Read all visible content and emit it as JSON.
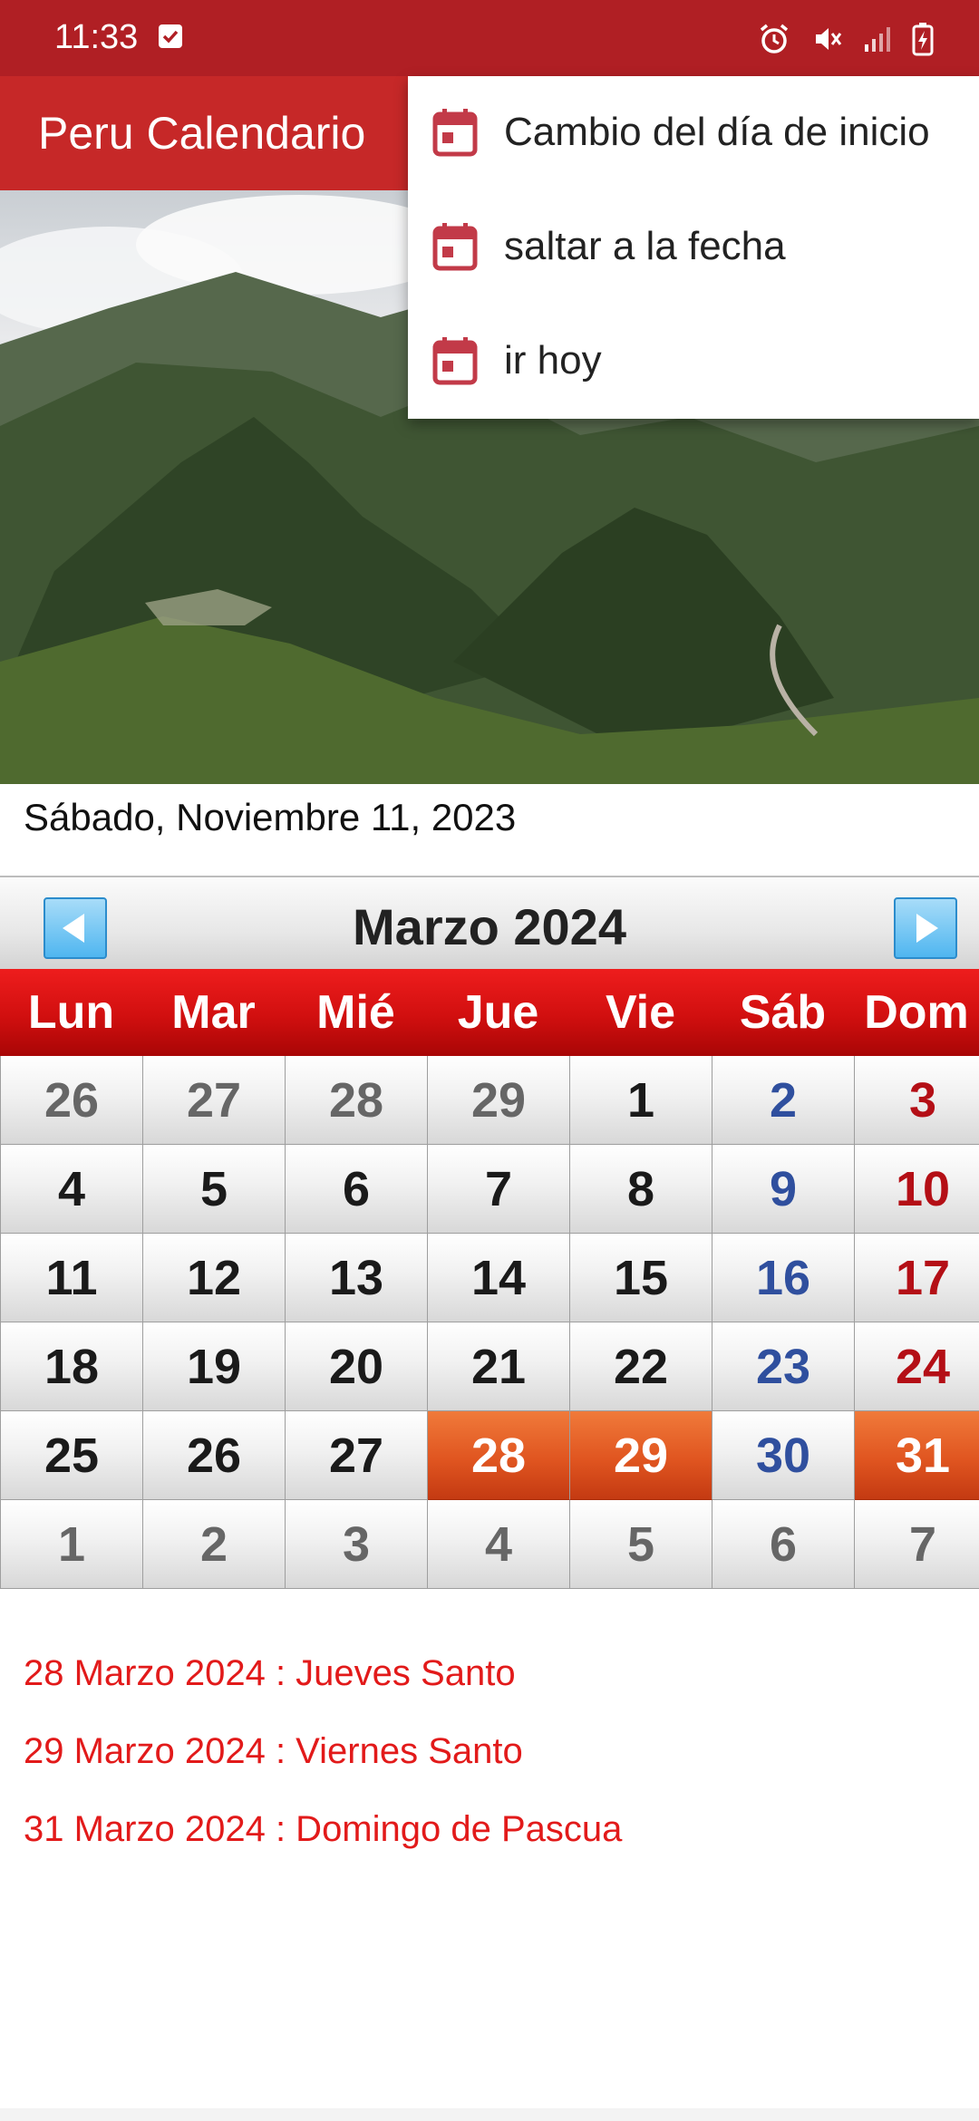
{
  "status_bar": {
    "time": "11:33",
    "icons": [
      "checkbox-icon",
      "alarm-icon",
      "vibrate-icon",
      "signal-icon",
      "battery-icon"
    ]
  },
  "app_bar": {
    "title": "Peru Calendario"
  },
  "menu": {
    "items": [
      {
        "label": "Cambio del día de inicio",
        "icon": "calendar-icon"
      },
      {
        "label": "saltar a la fecha",
        "icon": "calendar-icon"
      },
      {
        "label": "ir hoy",
        "icon": "calendar-icon"
      }
    ]
  },
  "today": "Sábado, Noviembre 11, 2023",
  "calendar": {
    "month_title": "Marzo  2024",
    "weekdays": [
      "Lun",
      "Mar",
      "Mié",
      "Jue",
      "Vie",
      "Sáb",
      "Dom"
    ],
    "weeks": [
      [
        "26",
        "27",
        "28",
        "29",
        "1",
        "2",
        "3"
      ],
      [
        "4",
        "5",
        "6",
        "7",
        "8",
        "9",
        "10"
      ],
      [
        "11",
        "12",
        "13",
        "14",
        "15",
        "16",
        "17"
      ],
      [
        "18",
        "19",
        "20",
        "21",
        "22",
        "23",
        "24"
      ],
      [
        "25",
        "26",
        "27",
        "28",
        "29",
        "30",
        "31"
      ],
      [
        "1",
        "2",
        "3",
        "4",
        "5",
        "6",
        "7"
      ]
    ],
    "highlighted_days": [
      "28",
      "29",
      "31"
    ]
  },
  "holidays": [
    "28 Marzo 2024 : Jueves Santo",
    "29 Marzo 2024 : Viernes Santo",
    "31 Marzo 2024 : Domingo de Pascua"
  ],
  "colors": {
    "status_bar": "#b01f24",
    "app_bar": "#c62828",
    "holiday_text": "#e21a1a",
    "saturday": "#2f4f9e",
    "sunday": "#b40f16",
    "holiday_cell": "#e05520"
  }
}
